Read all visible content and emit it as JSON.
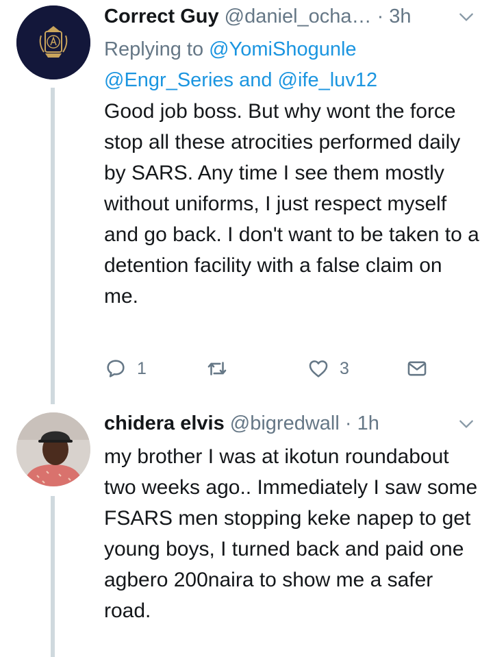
{
  "tweets": [
    {
      "name": "Correct Guy",
      "handle": "@daniel_ocha…",
      "time": "· 3h",
      "replying_prefix": "Replying to",
      "mentions": [
        "@YomiShogunle",
        "@Engr_Series",
        "@ife_luv12"
      ],
      "mention_joiner": "and",
      "text": "Good job boss. But why wont the force stop all these atrocities performed daily by SARS. Any time I see them mostly without uniforms, I just respect myself and go back. I don't want to be taken to a detention facility with a false claim on me.",
      "reply_count": "1",
      "like_count": "3",
      "avatar_icon": "logo-avatar-icon",
      "avatar_colors": {
        "bg": "#13173a",
        "emblem": "#c9a45c"
      }
    },
    {
      "name": "chidera elvis",
      "handle": "@bigredwall",
      "time": "· 1h",
      "text": "my brother I was at ikotun roundabout two weeks ago.. Immediately I saw some FSARS men stopping keke napep to get young boys, I turned back and paid one agbero 200naira to show me a safer road.",
      "avatar_icon": "user-photo-avatar"
    }
  ],
  "icons": {
    "reply": "reply-icon",
    "retweet": "retweet-icon",
    "like": "heart-icon",
    "dm": "message-icon",
    "more": "chevron-down-icon"
  },
  "colors": {
    "link": "#1b95e0",
    "secondary_text": "#657786",
    "thread_line": "#cfd9de"
  }
}
